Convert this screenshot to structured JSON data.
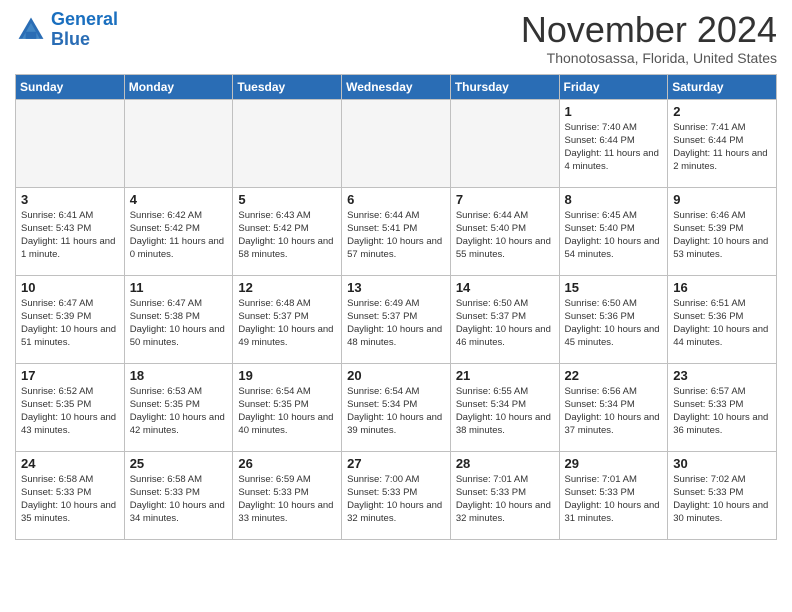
{
  "logo": {
    "text_general": "General",
    "text_blue": "Blue"
  },
  "header": {
    "month_year": "November 2024",
    "location": "Thonotosassa, Florida, United States"
  },
  "days_of_week": [
    "Sunday",
    "Monday",
    "Tuesday",
    "Wednesday",
    "Thursday",
    "Friday",
    "Saturday"
  ],
  "weeks": [
    [
      {
        "day": "",
        "empty": true
      },
      {
        "day": "",
        "empty": true
      },
      {
        "day": "",
        "empty": true
      },
      {
        "day": "",
        "empty": true
      },
      {
        "day": "",
        "empty": true
      },
      {
        "day": "1",
        "sunrise": "Sunrise: 7:40 AM",
        "sunset": "Sunset: 6:44 PM",
        "daylight": "Daylight: 11 hours and 4 minutes."
      },
      {
        "day": "2",
        "sunrise": "Sunrise: 7:41 AM",
        "sunset": "Sunset: 6:44 PM",
        "daylight": "Daylight: 11 hours and 2 minutes."
      }
    ],
    [
      {
        "day": "3",
        "sunrise": "Sunrise: 6:41 AM",
        "sunset": "Sunset: 5:43 PM",
        "daylight": "Daylight: 11 hours and 1 minute."
      },
      {
        "day": "4",
        "sunrise": "Sunrise: 6:42 AM",
        "sunset": "Sunset: 5:42 PM",
        "daylight": "Daylight: 11 hours and 0 minutes."
      },
      {
        "day": "5",
        "sunrise": "Sunrise: 6:43 AM",
        "sunset": "Sunset: 5:42 PM",
        "daylight": "Daylight: 10 hours and 58 minutes."
      },
      {
        "day": "6",
        "sunrise": "Sunrise: 6:44 AM",
        "sunset": "Sunset: 5:41 PM",
        "daylight": "Daylight: 10 hours and 57 minutes."
      },
      {
        "day": "7",
        "sunrise": "Sunrise: 6:44 AM",
        "sunset": "Sunset: 5:40 PM",
        "daylight": "Daylight: 10 hours and 55 minutes."
      },
      {
        "day": "8",
        "sunrise": "Sunrise: 6:45 AM",
        "sunset": "Sunset: 5:40 PM",
        "daylight": "Daylight: 10 hours and 54 minutes."
      },
      {
        "day": "9",
        "sunrise": "Sunrise: 6:46 AM",
        "sunset": "Sunset: 5:39 PM",
        "daylight": "Daylight: 10 hours and 53 minutes."
      }
    ],
    [
      {
        "day": "10",
        "sunrise": "Sunrise: 6:47 AM",
        "sunset": "Sunset: 5:39 PM",
        "daylight": "Daylight: 10 hours and 51 minutes."
      },
      {
        "day": "11",
        "sunrise": "Sunrise: 6:47 AM",
        "sunset": "Sunset: 5:38 PM",
        "daylight": "Daylight: 10 hours and 50 minutes."
      },
      {
        "day": "12",
        "sunrise": "Sunrise: 6:48 AM",
        "sunset": "Sunset: 5:37 PM",
        "daylight": "Daylight: 10 hours and 49 minutes."
      },
      {
        "day": "13",
        "sunrise": "Sunrise: 6:49 AM",
        "sunset": "Sunset: 5:37 PM",
        "daylight": "Daylight: 10 hours and 48 minutes."
      },
      {
        "day": "14",
        "sunrise": "Sunrise: 6:50 AM",
        "sunset": "Sunset: 5:37 PM",
        "daylight": "Daylight: 10 hours and 46 minutes."
      },
      {
        "day": "15",
        "sunrise": "Sunrise: 6:50 AM",
        "sunset": "Sunset: 5:36 PM",
        "daylight": "Daylight: 10 hours and 45 minutes."
      },
      {
        "day": "16",
        "sunrise": "Sunrise: 6:51 AM",
        "sunset": "Sunset: 5:36 PM",
        "daylight": "Daylight: 10 hours and 44 minutes."
      }
    ],
    [
      {
        "day": "17",
        "sunrise": "Sunrise: 6:52 AM",
        "sunset": "Sunset: 5:35 PM",
        "daylight": "Daylight: 10 hours and 43 minutes."
      },
      {
        "day": "18",
        "sunrise": "Sunrise: 6:53 AM",
        "sunset": "Sunset: 5:35 PM",
        "daylight": "Daylight: 10 hours and 42 minutes."
      },
      {
        "day": "19",
        "sunrise": "Sunrise: 6:54 AM",
        "sunset": "Sunset: 5:35 PM",
        "daylight": "Daylight: 10 hours and 40 minutes."
      },
      {
        "day": "20",
        "sunrise": "Sunrise: 6:54 AM",
        "sunset": "Sunset: 5:34 PM",
        "daylight": "Daylight: 10 hours and 39 minutes."
      },
      {
        "day": "21",
        "sunrise": "Sunrise: 6:55 AM",
        "sunset": "Sunset: 5:34 PM",
        "daylight": "Daylight: 10 hours and 38 minutes."
      },
      {
        "day": "22",
        "sunrise": "Sunrise: 6:56 AM",
        "sunset": "Sunset: 5:34 PM",
        "daylight": "Daylight: 10 hours and 37 minutes."
      },
      {
        "day": "23",
        "sunrise": "Sunrise: 6:57 AM",
        "sunset": "Sunset: 5:33 PM",
        "daylight": "Daylight: 10 hours and 36 minutes."
      }
    ],
    [
      {
        "day": "24",
        "sunrise": "Sunrise: 6:58 AM",
        "sunset": "Sunset: 5:33 PM",
        "daylight": "Daylight: 10 hours and 35 minutes."
      },
      {
        "day": "25",
        "sunrise": "Sunrise: 6:58 AM",
        "sunset": "Sunset: 5:33 PM",
        "daylight": "Daylight: 10 hours and 34 minutes."
      },
      {
        "day": "26",
        "sunrise": "Sunrise: 6:59 AM",
        "sunset": "Sunset: 5:33 PM",
        "daylight": "Daylight: 10 hours and 33 minutes."
      },
      {
        "day": "27",
        "sunrise": "Sunrise: 7:00 AM",
        "sunset": "Sunset: 5:33 PM",
        "daylight": "Daylight: 10 hours and 32 minutes."
      },
      {
        "day": "28",
        "sunrise": "Sunrise: 7:01 AM",
        "sunset": "Sunset: 5:33 PM",
        "daylight": "Daylight: 10 hours and 32 minutes."
      },
      {
        "day": "29",
        "sunrise": "Sunrise: 7:01 AM",
        "sunset": "Sunset: 5:33 PM",
        "daylight": "Daylight: 10 hours and 31 minutes."
      },
      {
        "day": "30",
        "sunrise": "Sunrise: 7:02 AM",
        "sunset": "Sunset: 5:33 PM",
        "daylight": "Daylight: 10 hours and 30 minutes."
      }
    ]
  ]
}
